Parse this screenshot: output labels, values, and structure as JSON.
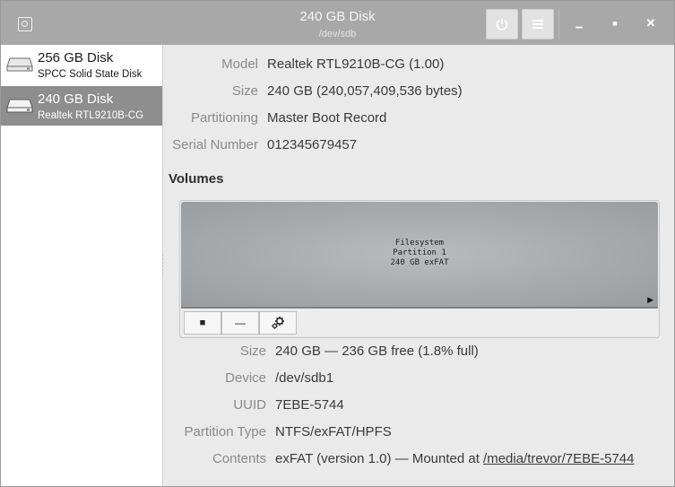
{
  "window": {
    "title": "240 GB Disk",
    "subtitle": "/dev/sdb"
  },
  "toolbar": {
    "power_icon": "power-icon",
    "menu_icon": "menu-icon"
  },
  "window_controls": {
    "minimize_glyph": "▁",
    "maximize_glyph": "■",
    "close_glyph": "✕"
  },
  "sidebar": {
    "items": [
      {
        "name": "256 GB Disk",
        "model": "SPCC Solid State Disk",
        "selected": false
      },
      {
        "name": "240 GB Disk",
        "model": "Realtek RTL9210B-CG",
        "selected": true
      }
    ]
  },
  "drive": {
    "fields": [
      {
        "label": "Model",
        "value": "Realtek RTL9210B-CG (1.00)"
      },
      {
        "label": "Size",
        "value": "240 GB (240,057,409,536 bytes)"
      },
      {
        "label": "Partitioning",
        "value": "Master Boot Record"
      },
      {
        "label": "Serial Number",
        "value": "012345679457"
      }
    ]
  },
  "volumes": {
    "title": "Volumes",
    "partition": {
      "line1": "Filesystem",
      "line2": "Partition 1",
      "line3": "240 GB exFAT"
    },
    "buttons": {
      "stop_glyph": "■",
      "remove_glyph": "—"
    },
    "fields": [
      {
        "label": "Size",
        "value": "240 GB — 236 GB free (1.8% full)"
      },
      {
        "label": "Device",
        "value": "/dev/sdb1"
      },
      {
        "label": "UUID",
        "value": "7EBE-5744"
      },
      {
        "label": "Partition Type",
        "value": "NTFS/exFAT/HPFS"
      },
      {
        "label": "Contents",
        "value": "exFAT (version 1.0) — Mounted at ",
        "link": "/media/trevor/7EBE-5744"
      }
    ]
  }
}
